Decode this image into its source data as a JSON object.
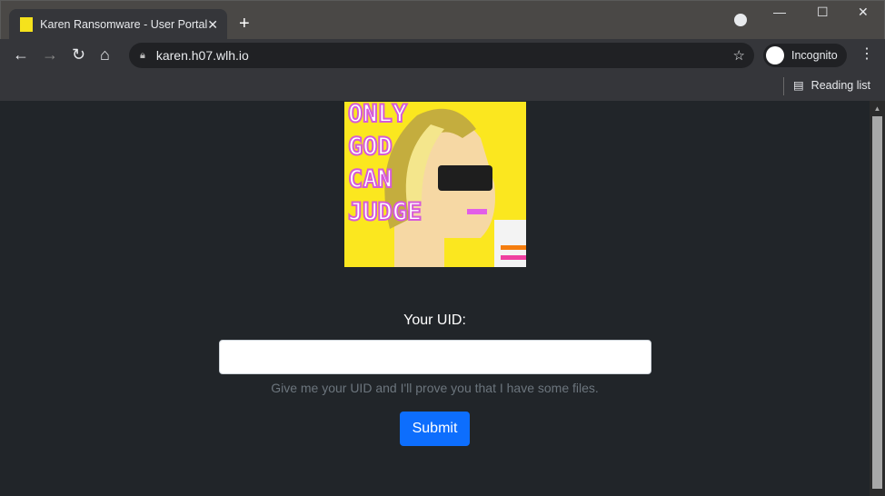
{
  "browser": {
    "tab_title": "Karen Ransomware - User Portal",
    "url": "karen.h07.wlh.io",
    "profile": "Incognito",
    "reading_list": "Reading list"
  },
  "image": {
    "lettering": "ONLY GOD CAN JUDGE"
  },
  "form": {
    "label": "Your UID:",
    "value": "",
    "help": "Give me your UID and I'll prove you that I have some files.",
    "submit": "Submit",
    "primary_color": "#0d6efd"
  }
}
